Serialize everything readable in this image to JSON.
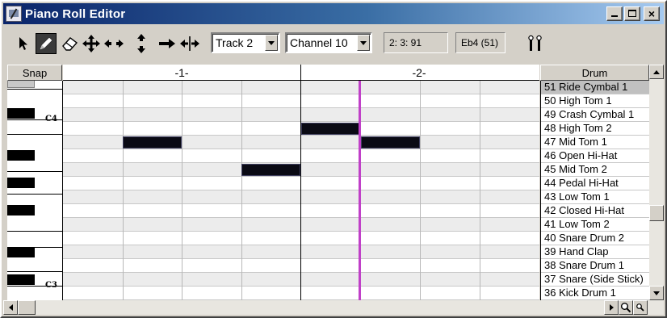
{
  "window": {
    "title": "Piano Roll Editor",
    "minimize_label": "",
    "maximize_label": "",
    "close_label": "×"
  },
  "toolbar": {
    "tools": [
      {
        "name": "select-tool",
        "icon": "arrow-pointer-icon"
      },
      {
        "name": "draw-tool",
        "icon": "pencil-icon",
        "active": true
      },
      {
        "name": "erase-tool",
        "icon": "eraser-icon"
      },
      {
        "name": "move-tool",
        "icon": "four-way-arrow-icon"
      },
      {
        "name": "horizontal-move-tool",
        "icon": "horizontal-arrows-icon"
      },
      {
        "name": "vertical-move-tool",
        "icon": "vertical-arrows-icon"
      },
      {
        "name": "right-arrow-tool",
        "icon": "right-arrow-icon"
      },
      {
        "name": "horizontal-scale-tool",
        "icon": "horizontal-scale-icon"
      }
    ],
    "track_select": {
      "value": "Track 2"
    },
    "channel_select": {
      "value": "Channel 10"
    },
    "position_readout": "2:  3:  91",
    "pitch_readout": "Eb4 (51)",
    "tuning_icon": "tuning-fork-icon"
  },
  "piano_roll": {
    "snap_label": "Snap",
    "bar_labels": [
      "-1-",
      "-2-"
    ],
    "key_labels": {
      "c4": "C4",
      "c3": "C3"
    },
    "cursor_color": "#c040c8",
    "note_color": "#0a0a14"
  },
  "drum_map": {
    "header": "Drum",
    "items": [
      {
        "num": "51",
        "name": "Ride Cymbal 1",
        "selected": true
      },
      {
        "num": "50",
        "name": "High Tom 1"
      },
      {
        "num": "49",
        "name": "Crash Cymbal 1"
      },
      {
        "num": "48",
        "name": "High Tom 2"
      },
      {
        "num": "47",
        "name": "Mid Tom 1"
      },
      {
        "num": "46",
        "name": "Open Hi-Hat"
      },
      {
        "num": "45",
        "name": "Mid Tom 2"
      },
      {
        "num": "44",
        "name": "Pedal Hi-Hat"
      },
      {
        "num": "43",
        "name": "Low Tom 1"
      },
      {
        "num": "42",
        "name": "Closed Hi-Hat"
      },
      {
        "num": "41",
        "name": "Low Tom 2"
      },
      {
        "num": "40",
        "name": "Snare Drum 2"
      },
      {
        "num": "39",
        "name": "Hand Clap"
      },
      {
        "num": "38",
        "name": "Snare Drum 1"
      },
      {
        "num": "37",
        "name": "Snare (Side Stick)"
      },
      {
        "num": "36",
        "name": "Kick Drum 1"
      }
    ]
  }
}
